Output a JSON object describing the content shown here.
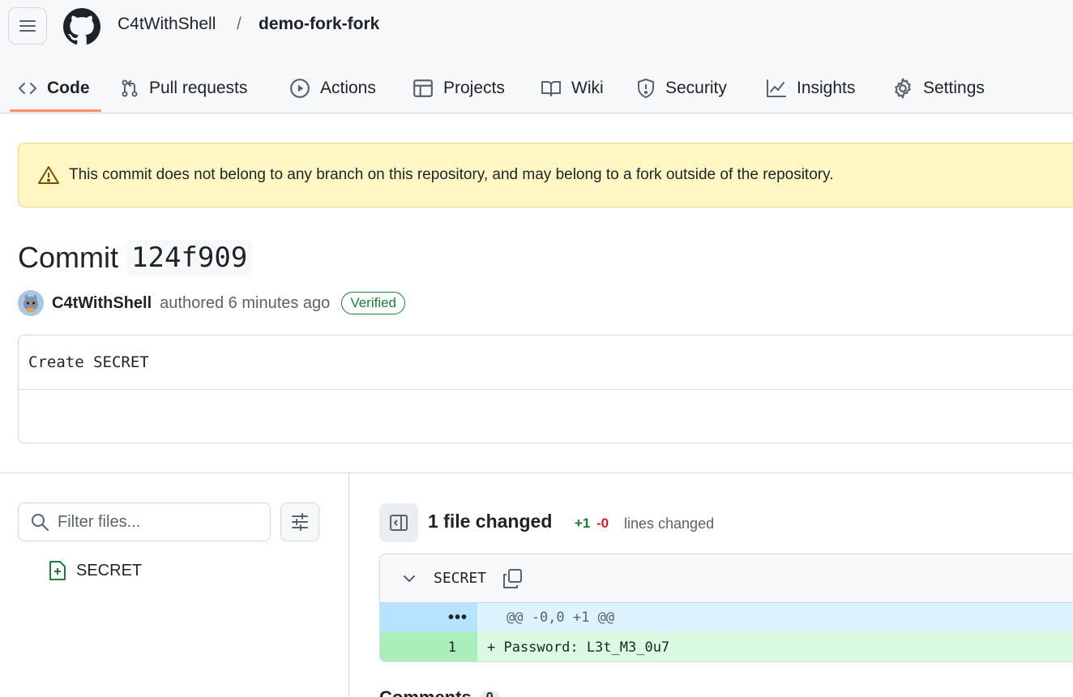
{
  "header": {
    "owner": "C4tWithShell",
    "separator": "/",
    "repo": "demo-fork-fork"
  },
  "tabs": [
    {
      "label": "Code",
      "icon": "code-icon"
    },
    {
      "label": "Pull requests",
      "icon": "git-pull-request-icon"
    },
    {
      "label": "Actions",
      "icon": "play-icon"
    },
    {
      "label": "Projects",
      "icon": "table-icon"
    },
    {
      "label": "Wiki",
      "icon": "book-icon"
    },
    {
      "label": "Security",
      "icon": "shield-icon"
    },
    {
      "label": "Insights",
      "icon": "graph-icon"
    },
    {
      "label": "Settings",
      "icon": "gear-icon"
    }
  ],
  "banner": {
    "text": "This commit does not belong to any branch on this repository, and may belong to a fork outside of the repository."
  },
  "commit": {
    "title_prefix": "Commit",
    "sha": "124f909",
    "author": "C4tWithShell",
    "authored_text": "authored 6 minutes ago",
    "verified": "Verified",
    "message": "Create SECRET"
  },
  "files": {
    "filter_placeholder": "Filter files...",
    "items": [
      "SECRET"
    ]
  },
  "diff": {
    "files_changed": "1 file changed",
    "additions": "+1",
    "deletions": "-0",
    "lines_changed": "lines changed",
    "file_name": "SECRET",
    "hunk_marker": "•••",
    "hunk_header": "@@ -0,0 +1 @@",
    "line_number": "1",
    "line_text": "+ Password: L3t_M3_0u7"
  },
  "comments": {
    "label": "Comments",
    "count": "0"
  },
  "colors": {
    "accent_underline": "#fd8c73",
    "banner_bg": "#fff8c5",
    "verified_green": "#1a7f37",
    "deletion_red": "#d1242f",
    "addition_bg": "#dafbe1",
    "hunk_bg": "#ddf4ff"
  }
}
